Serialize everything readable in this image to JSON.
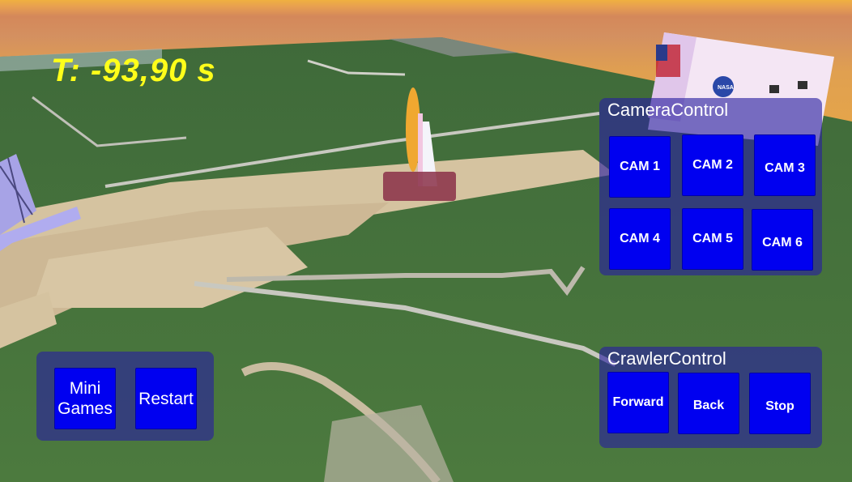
{
  "hud": {
    "timer_label": "T: -93,90 s",
    "timer_color": "#ffff1a"
  },
  "camera_control": {
    "title": "CameraControl",
    "buttons": [
      {
        "label": "CAM 1"
      },
      {
        "label": "CAM 2"
      },
      {
        "label": "CAM 3"
      },
      {
        "label": "CAM 4"
      },
      {
        "label": "CAM 5"
      },
      {
        "label": "CAM 6"
      }
    ]
  },
  "crawler_control": {
    "title": "CrawlerControl",
    "buttons": [
      {
        "label": "Forward"
      },
      {
        "label": "Back"
      },
      {
        "label": "Stop"
      }
    ]
  },
  "game_menu": {
    "mini_games_label": "Mini\nGames",
    "restart_label": "Restart"
  },
  "colors": {
    "button_blue": "#0000f0",
    "panel": "#281ea0"
  },
  "scene": {
    "building_logo": "NASA"
  }
}
